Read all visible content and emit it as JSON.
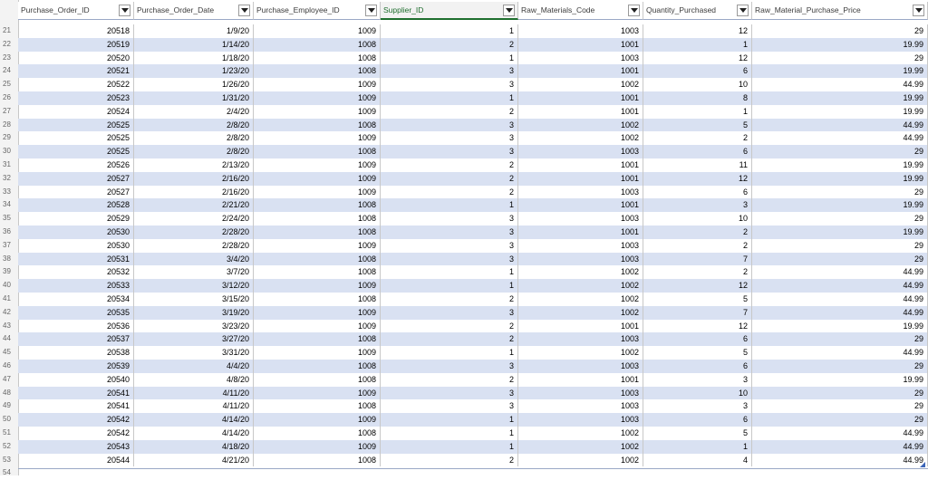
{
  "sheet": {
    "columns": [
      "Purchase_Order_ID",
      "Purchase_Order_Date",
      "Purchase_Employee_ID",
      "Supplier_ID",
      "Raw_Materials_Code",
      "Quantity_Purchased",
      "Raw_Material_Purchase_Price"
    ],
    "active_column": 3,
    "band_color": "#d9e1f2",
    "rows": [
      {
        "n": "21",
        "c": [
          "20518",
          "1/9/20",
          "1009",
          "1",
          "1003",
          "12",
          "29"
        ]
      },
      {
        "n": "22",
        "c": [
          "20519",
          "1/14/20",
          "1008",
          "2",
          "1001",
          "1",
          "19.99"
        ]
      },
      {
        "n": "23",
        "c": [
          "20520",
          "1/18/20",
          "1008",
          "1",
          "1003",
          "12",
          "29"
        ]
      },
      {
        "n": "24",
        "c": [
          "20521",
          "1/23/20",
          "1008",
          "3",
          "1001",
          "6",
          "19.99"
        ]
      },
      {
        "n": "25",
        "c": [
          "20522",
          "1/26/20",
          "1009",
          "3",
          "1002",
          "10",
          "44.99"
        ]
      },
      {
        "n": "26",
        "c": [
          "20523",
          "1/31/20",
          "1009",
          "1",
          "1001",
          "8",
          "19.99"
        ]
      },
      {
        "n": "27",
        "c": [
          "20524",
          "2/4/20",
          "1009",
          "2",
          "1001",
          "1",
          "19.99"
        ]
      },
      {
        "n": "28",
        "c": [
          "20525",
          "2/8/20",
          "1008",
          "3",
          "1002",
          "5",
          "44.99"
        ]
      },
      {
        "n": "29",
        "c": [
          "20525",
          "2/8/20",
          "1009",
          "3",
          "1002",
          "2",
          "44.99"
        ]
      },
      {
        "n": "30",
        "c": [
          "20525",
          "2/8/20",
          "1008",
          "3",
          "1003",
          "6",
          "29"
        ]
      },
      {
        "n": "31",
        "c": [
          "20526",
          "2/13/20",
          "1009",
          "2",
          "1001",
          "11",
          "19.99"
        ]
      },
      {
        "n": "32",
        "c": [
          "20527",
          "2/16/20",
          "1009",
          "2",
          "1001",
          "12",
          "19.99"
        ]
      },
      {
        "n": "33",
        "c": [
          "20527",
          "2/16/20",
          "1009",
          "2",
          "1003",
          "6",
          "29"
        ]
      },
      {
        "n": "34",
        "c": [
          "20528",
          "2/21/20",
          "1008",
          "1",
          "1001",
          "3",
          "19.99"
        ]
      },
      {
        "n": "35",
        "c": [
          "20529",
          "2/24/20",
          "1008",
          "3",
          "1003",
          "10",
          "29"
        ]
      },
      {
        "n": "36",
        "c": [
          "20530",
          "2/28/20",
          "1008",
          "3",
          "1001",
          "2",
          "19.99"
        ]
      },
      {
        "n": "37",
        "c": [
          "20530",
          "2/28/20",
          "1009",
          "3",
          "1003",
          "2",
          "29"
        ]
      },
      {
        "n": "38",
        "c": [
          "20531",
          "3/4/20",
          "1008",
          "3",
          "1003",
          "7",
          "29"
        ]
      },
      {
        "n": "39",
        "c": [
          "20532",
          "3/7/20",
          "1008",
          "1",
          "1002",
          "2",
          "44.99"
        ]
      },
      {
        "n": "40",
        "c": [
          "20533",
          "3/12/20",
          "1009",
          "1",
          "1002",
          "12",
          "44.99"
        ]
      },
      {
        "n": "41",
        "c": [
          "20534",
          "3/15/20",
          "1008",
          "2",
          "1002",
          "5",
          "44.99"
        ]
      },
      {
        "n": "42",
        "c": [
          "20535",
          "3/19/20",
          "1009",
          "3",
          "1002",
          "7",
          "44.99"
        ]
      },
      {
        "n": "43",
        "c": [
          "20536",
          "3/23/20",
          "1009",
          "2",
          "1001",
          "12",
          "19.99"
        ]
      },
      {
        "n": "44",
        "c": [
          "20537",
          "3/27/20",
          "1008",
          "2",
          "1003",
          "6",
          "29"
        ]
      },
      {
        "n": "45",
        "c": [
          "20538",
          "3/31/20",
          "1009",
          "1",
          "1002",
          "5",
          "44.99"
        ]
      },
      {
        "n": "46",
        "c": [
          "20539",
          "4/4/20",
          "1008",
          "3",
          "1003",
          "6",
          "29"
        ]
      },
      {
        "n": "47",
        "c": [
          "20540",
          "4/8/20",
          "1008",
          "2",
          "1001",
          "3",
          "19.99"
        ]
      },
      {
        "n": "48",
        "c": [
          "20541",
          "4/11/20",
          "1009",
          "3",
          "1003",
          "10",
          "29"
        ]
      },
      {
        "n": "49",
        "c": [
          "20541",
          "4/11/20",
          "1008",
          "3",
          "1003",
          "3",
          "29"
        ]
      },
      {
        "n": "50",
        "c": [
          "20542",
          "4/14/20",
          "1009",
          "1",
          "1003",
          "6",
          "29"
        ]
      },
      {
        "n": "51",
        "c": [
          "20542",
          "4/14/20",
          "1008",
          "1",
          "1002",
          "5",
          "44.99"
        ]
      },
      {
        "n": "52",
        "c": [
          "20543",
          "4/18/20",
          "1009",
          "1",
          "1002",
          "1",
          "44.99"
        ]
      },
      {
        "n": "53",
        "c": [
          "20544",
          "4/21/20",
          "1008",
          "2",
          "1002",
          "4",
          "44.99"
        ]
      },
      {
        "n": "54",
        "c": []
      }
    ]
  }
}
